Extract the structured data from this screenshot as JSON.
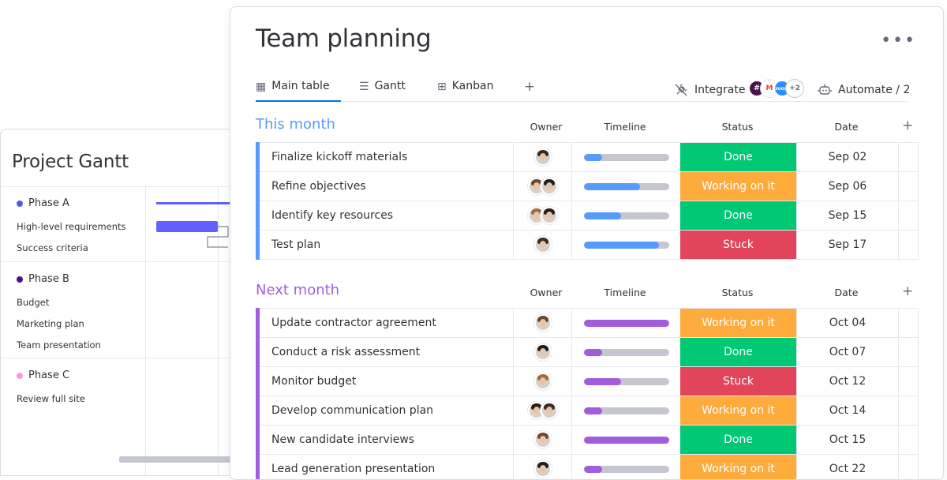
{
  "gantt": {
    "title": "Project Gantt",
    "phases": [
      {
        "label": "Phase A",
        "color": "#5559df",
        "items": [
          "High-level requirements",
          "Success criteria"
        ]
      },
      {
        "label": "Phase B",
        "color": "#401694",
        "items": [
          "Budget",
          "Marketing plan",
          "Team presentation"
        ]
      },
      {
        "label": "Phase C",
        "color": "#ff9bd6",
        "items": [
          "Review full site"
        ]
      }
    ]
  },
  "board": {
    "title": "Team planning",
    "more_label": "•••",
    "tabs": [
      {
        "label": "Main table",
        "icon": "table-icon",
        "glyph": "▦"
      },
      {
        "label": "Gantt",
        "icon": "gantt-icon",
        "glyph": "☰"
      },
      {
        "label": "Kanban",
        "icon": "kanban-icon",
        "glyph": "⊞"
      }
    ],
    "add_tab": "+",
    "integrate_label": "Integrate",
    "integrate_more": "+2",
    "automate_label": "Automate / 2",
    "columns": {
      "owner": "Owner",
      "timeline": "Timeline",
      "status": "Status",
      "date": "Date",
      "add": "+"
    },
    "status_colors": {
      "Done": "#00c875",
      "Working on it": "#fdab3d",
      "Stuck": "#e2445c"
    },
    "groups": [
      {
        "title": "This month",
        "color": "#579bfc",
        "rows": [
          {
            "name": "Finalize kickoff materials",
            "owners": 1,
            "progress": 0.22,
            "status": "Done",
            "date": "Sep 02"
          },
          {
            "name": "Refine objectives",
            "owners": 2,
            "progress": 0.66,
            "status": "Working on it",
            "date": "Sep 06"
          },
          {
            "name": "Identify key resources",
            "owners": 2,
            "progress": 0.44,
            "status": "Done",
            "date": "Sep 15"
          },
          {
            "name": "Test plan",
            "owners": 1,
            "progress": 0.88,
            "status": "Stuck",
            "date": "Sep 17"
          }
        ]
      },
      {
        "title": "Next month",
        "color": "#a25ddc",
        "rows": [
          {
            "name": "Update contractor agreement",
            "owners": 1,
            "progress": 1.0,
            "status": "Working on it",
            "date": "Oct 04"
          },
          {
            "name": "Conduct a risk assessment",
            "owners": 1,
            "progress": 0.22,
            "status": "Done",
            "date": "Oct 07"
          },
          {
            "name": "Monitor budget",
            "owners": 1,
            "progress": 0.44,
            "status": "Stuck",
            "date": "Oct 12"
          },
          {
            "name": "Develop communication plan",
            "owners": 2,
            "progress": 0.22,
            "status": "Working on it",
            "date": "Oct 14"
          },
          {
            "name": "New candidate interviews",
            "owners": 1,
            "progress": 1.0,
            "status": "Done",
            "date": "Oct 15"
          },
          {
            "name": "Lead generation presentation",
            "owners": 1,
            "progress": 0.22,
            "status": "Working on it",
            "date": "Oct 22"
          }
        ]
      }
    ]
  }
}
